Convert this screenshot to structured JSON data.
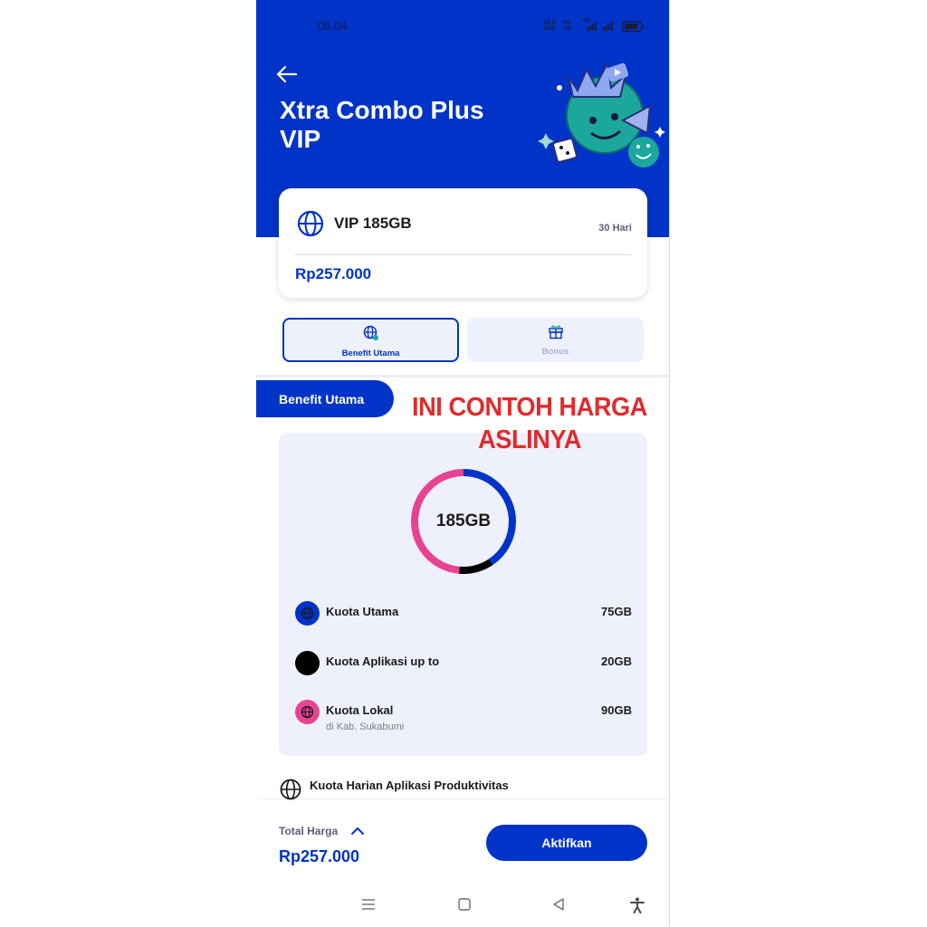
{
  "status_bar": {
    "time": "08.04",
    "net_speed_value": "20,0",
    "net_speed_unit": "KB/S",
    "volte_top": "Vo",
    "volte_bottom": "LTE",
    "network_type": "4G",
    "battery_icon": "battery-icon"
  },
  "header": {
    "back_icon": "arrow-left-icon",
    "title_line1": "Xtra Combo Plus",
    "title_line2": "VIP",
    "bg_color": "#0033c7"
  },
  "package": {
    "name": "VIP 185GB",
    "duration": "30 Hari",
    "price": "Rp257.000"
  },
  "tabs": [
    {
      "label": "Benefit Utama",
      "icon": "globe-icon",
      "active": true
    },
    {
      "label": "Bonus",
      "icon": "gift-icon",
      "active": false
    }
  ],
  "section": {
    "title": "Benefit Utama"
  },
  "overlay": {
    "line1": "INI CONTOH HARGA",
    "line2": "ASLINYA",
    "color": "#e02c2c"
  },
  "quota": {
    "total_label": "185GB",
    "items": [
      {
        "name": "Kuota Utama",
        "sub": "",
        "value": "75GB",
        "color": "#0033c7",
        "icon": "globe-icon"
      },
      {
        "name": "Kuota Aplikasi up to",
        "sub": "",
        "value": "20GB",
        "color": "#000000",
        "icon": ""
      },
      {
        "name": "Kuota Lokal",
        "sub": "di Kab. Sukabumi",
        "value": "90GB",
        "color": "#e84393",
        "icon": "globe-icon"
      }
    ]
  },
  "extra_benefit": {
    "label": "Kuota Harian Aplikasi Produktivitas",
    "icon": "globe-icon"
  },
  "footer": {
    "total_label": "Total Harga",
    "total_price": "Rp257.000",
    "activate_label": "Aktifkan"
  },
  "system_nav": {
    "menu_icon": "menu-icon",
    "home_icon": "square-icon",
    "back_icon": "triangle-back-icon",
    "accessibility_icon": "accessibility-icon"
  }
}
